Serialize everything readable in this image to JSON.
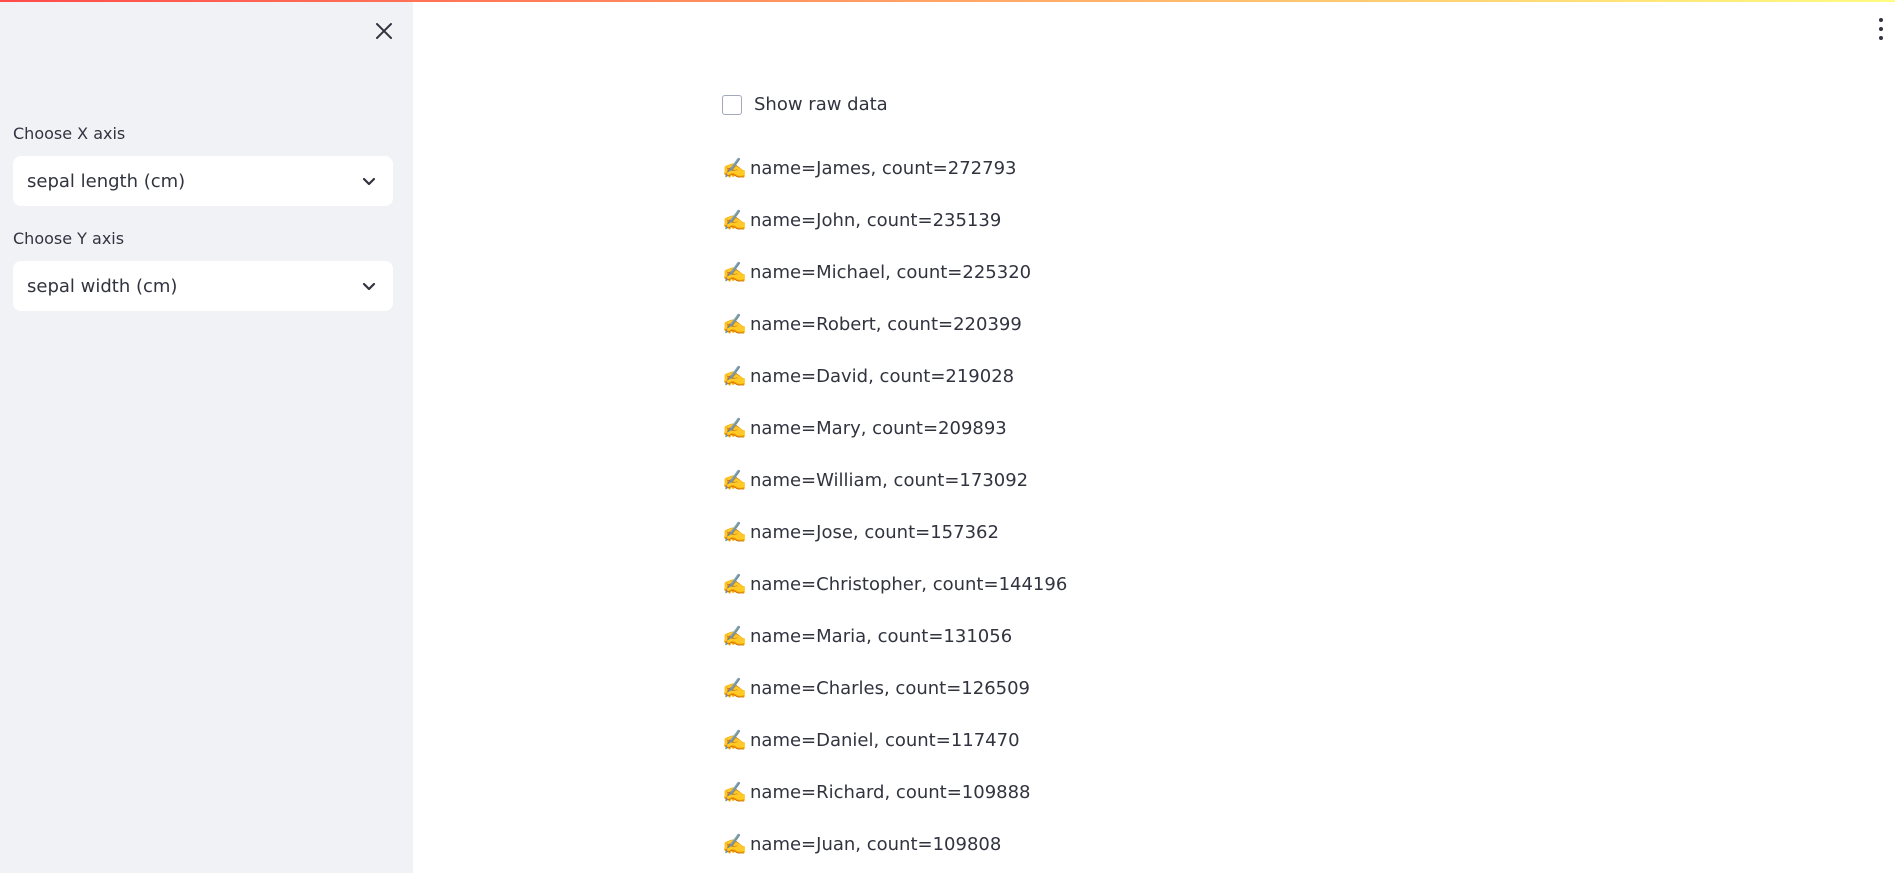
{
  "sidebar": {
    "x_axis": {
      "label": "Choose X axis",
      "value": "sepal length (cm)"
    },
    "y_axis": {
      "label": "Choose Y axis",
      "value": "sepal width (cm)"
    }
  },
  "main": {
    "checkbox_label": "Show raw data",
    "emoji": "✍️",
    "items": [
      "name=James, count=272793",
      "name=John, count=235139",
      "name=Michael, count=225320",
      "name=Robert, count=220399",
      "name=David, count=219028",
      "name=Mary, count=209893",
      "name=William, count=173092",
      "name=Jose, count=157362",
      "name=Christopher, count=144196",
      "name=Maria, count=131056",
      "name=Charles, count=126509",
      "name=Daniel, count=117470",
      "name=Richard, count=109888",
      "name=Juan, count=109808"
    ]
  },
  "colors": {
    "sidebar_bg": "#f0f2f6",
    "accent_gradient_start": "#ff4b4b",
    "accent_gradient_end": "#fffd80",
    "text": "#31333f"
  }
}
